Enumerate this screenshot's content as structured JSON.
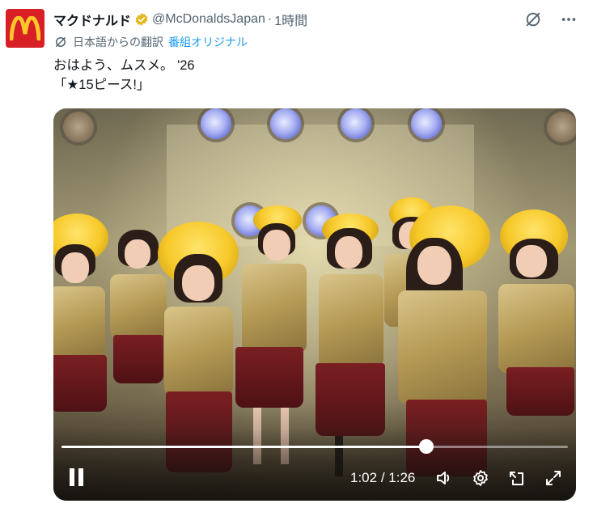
{
  "account": {
    "name": "マクドナルド",
    "handle": "@McDonaldsJapan",
    "separator": "·",
    "time": "1時間",
    "brand_color": "#d81f26",
    "verified_badge_color": "#e2b719"
  },
  "translation": {
    "label": "日本語からの翻訳",
    "link": "番組オリジナル",
    "icon": "translate-icon"
  },
  "post": {
    "line1": "おはよう、ムスメ。 '26",
    "line2": "「★15ピース!」"
  },
  "video": {
    "elapsed": "1:02",
    "slash": "/",
    "duration": "1:26",
    "time_readout": "1:02 / 1:26",
    "progress_fraction": 0.721,
    "controls": [
      "pause-icon",
      "volume-icon",
      "settings-icon",
      "pip-icon",
      "fullscreen-icon"
    ]
  },
  "top_icons": [
    "grok-icon",
    "more-icon"
  ]
}
